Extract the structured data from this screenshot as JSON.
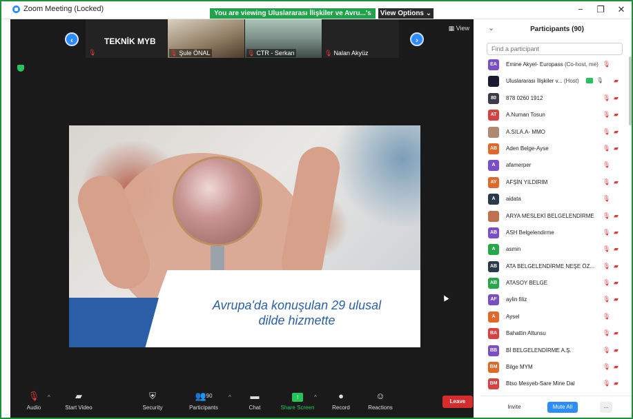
{
  "window": {
    "title": "Zoom Meeting (Locked)",
    "share_banner": "You are viewing Uluslararası İlişkiler ve Avru...'s screen",
    "view_options": "View Options ⌄",
    "minimize": "−",
    "restore": "❐",
    "close": "✕"
  },
  "colors": {
    "accent": "#2D8CFF",
    "share_green": "#1fa34a",
    "muted_red": "#e03a3a",
    "leave_red": "#d72c2c",
    "meeting_bg": "#1a1a1a"
  },
  "thumbnails": {
    "prev_arrow": "‹",
    "next_arrow": "›",
    "view_label": "▦ View",
    "items": [
      {
        "big_text": "TEKNİK MYB",
        "label": ""
      },
      {
        "big_text": "",
        "label": "Şule ÖNAL"
      },
      {
        "big_text": "",
        "label": "CTR - Serkan"
      },
      {
        "big_text": "",
        "label": "Nalan Akyüz"
      }
    ]
  },
  "slide": {
    "caption_line1": "Avrupa'da konuşulan 29 ulusal",
    "caption_line2": "dilde hizmette"
  },
  "toolbar": {
    "audio": "Audio",
    "start_video": "Start Video",
    "security": "Security",
    "participants": "Participants",
    "participants_count": "90",
    "chat": "Chat",
    "share_screen": "Share Screen",
    "record": "Record",
    "reactions": "Reactions",
    "leave": "Leave"
  },
  "panel": {
    "title": "Participants (90)",
    "collapse_icon": "⌄",
    "search_placeholder": "Find a participant",
    "invite": "Invite",
    "mute_all": "Mute All",
    "more": "..."
  },
  "participants": [
    {
      "initials": "EA",
      "name": "Emine Akyel- Europass",
      "role": "(Co-host, me)",
      "color": "#7a4ec6",
      "mic_muted": true,
      "cam_off": false
    },
    {
      "initials": "",
      "name": "Uluslararası İlişkiler v...",
      "role": "(Host)",
      "color": "#1a1a2e",
      "host": true
    },
    {
      "initials": "80",
      "name": "878 0260 1912",
      "role": "",
      "color": "#3a3a4a",
      "mic_muted": true,
      "cam_off": true
    },
    {
      "initials": "AT",
      "name": "A.Numan Tosun",
      "role": "",
      "color": "#d94141",
      "mic_muted": true,
      "cam_off": true
    },
    {
      "initials": "",
      "name": "A.SILA.A- MMO",
      "role": "",
      "color": "#b08870",
      "mic_muted": true,
      "cam_off": true
    },
    {
      "initials": "AB",
      "name": "Aden Belge-Ayse",
      "role": "",
      "color": "#e0692a",
      "mic_muted": true,
      "cam_off": true
    },
    {
      "initials": "A",
      "name": "afamerper",
      "role": "",
      "color": "#7a4ec6",
      "mic_muted": true,
      "cam_off": false
    },
    {
      "initials": "AY",
      "name": "AFŞİN YILDIRIM",
      "role": "",
      "color": "#e0692a",
      "mic_muted": true,
      "cam_off": true
    },
    {
      "initials": "A",
      "name": "aidata",
      "role": "",
      "color": "#2a3a4a",
      "mic_muted": true,
      "cam_off": false
    },
    {
      "initials": "",
      "name": "ARYA MESLEKİ BELGELENDİRME",
      "role": "",
      "color": "#c07050",
      "mic_muted": true,
      "cam_off": true
    },
    {
      "initials": "AB",
      "name": "ASH Belgelendirme",
      "role": "",
      "color": "#7a4ec6",
      "mic_muted": true,
      "cam_off": true
    },
    {
      "initials": "A",
      "name": "asmin",
      "role": "",
      "color": "#25a84a",
      "mic_muted": true,
      "cam_off": true
    },
    {
      "initials": "AB",
      "name": "ATA BELGELENDİRME NEŞE ÖZ...",
      "role": "",
      "color": "#2a3a4a",
      "mic_muted": true,
      "cam_off": true
    },
    {
      "initials": "AB",
      "name": "ATASOY BELGE",
      "role": "",
      "color": "#25a84a",
      "mic_muted": true,
      "cam_off": true
    },
    {
      "initials": "AF",
      "name": "aylin filiz",
      "role": "",
      "color": "#7a4ec6",
      "mic_muted": true,
      "cam_off": true
    },
    {
      "initials": "A",
      "name": "Aysel",
      "role": "",
      "color": "#e0692a",
      "mic_muted": true,
      "cam_off": false
    },
    {
      "initials": "BA",
      "name": "Bahattin Altunsu",
      "role": "",
      "color": "#d94141",
      "mic_muted": true,
      "cam_off": true
    },
    {
      "initials": "BB",
      "name": "Bİ BELGELENDİRME A.Ş.",
      "role": "",
      "color": "#7a4ec6",
      "mic_muted": true,
      "cam_off": true
    },
    {
      "initials": "BM",
      "name": "Bilge MYM",
      "role": "",
      "color": "#e0692a",
      "mic_muted": true,
      "cam_off": true
    },
    {
      "initials": "BM",
      "name": "Btso Mesyeb-Sare Mine Dal",
      "role": "",
      "color": "#d94141",
      "mic_muted": true,
      "cam_off": true
    }
  ]
}
